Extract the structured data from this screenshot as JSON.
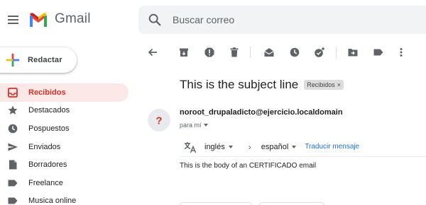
{
  "app": {
    "name": "Gmail"
  },
  "search": {
    "placeholder": "Buscar correo"
  },
  "compose": {
    "label": "Redactar"
  },
  "sidebar": {
    "items": [
      {
        "label": "Recibidos",
        "icon": "inbox-icon",
        "active": true
      },
      {
        "label": "Destacados",
        "icon": "star-icon",
        "active": false
      },
      {
        "label": "Pospuestos",
        "icon": "clock-icon",
        "active": false
      },
      {
        "label": "Enviados",
        "icon": "send-icon",
        "active": false
      },
      {
        "label": "Borradores",
        "icon": "draft-icon",
        "active": false
      },
      {
        "label": "Freelance",
        "icon": "label-icon",
        "active": false
      },
      {
        "label": "Musica online",
        "icon": "label-icon",
        "active": false
      }
    ]
  },
  "toolbar": {
    "icons": [
      "back-arrow-icon",
      "archive-icon",
      "report-spam-icon",
      "delete-icon",
      "mark-unread-icon",
      "snooze-icon",
      "add-task-icon",
      "move-to-icon",
      "labels-icon",
      "more-vert-icon"
    ]
  },
  "message": {
    "subject": "This is the subject line",
    "label_chip": "Recibidos",
    "sender": "noroot_drupaladicto@ejercicio.localdomain",
    "to": "para mí",
    "body": "This is the body of an CERTIFICADO email"
  },
  "translate": {
    "from": "inglés",
    "to": "español",
    "link": "Traducir mensaje"
  },
  "colors": {
    "accent_red": "#d93025",
    "active_bg": "#fce8e6",
    "link_blue": "#1a73e8",
    "icon_gray": "#5f6368",
    "search_bg": "#f1f3f4"
  }
}
